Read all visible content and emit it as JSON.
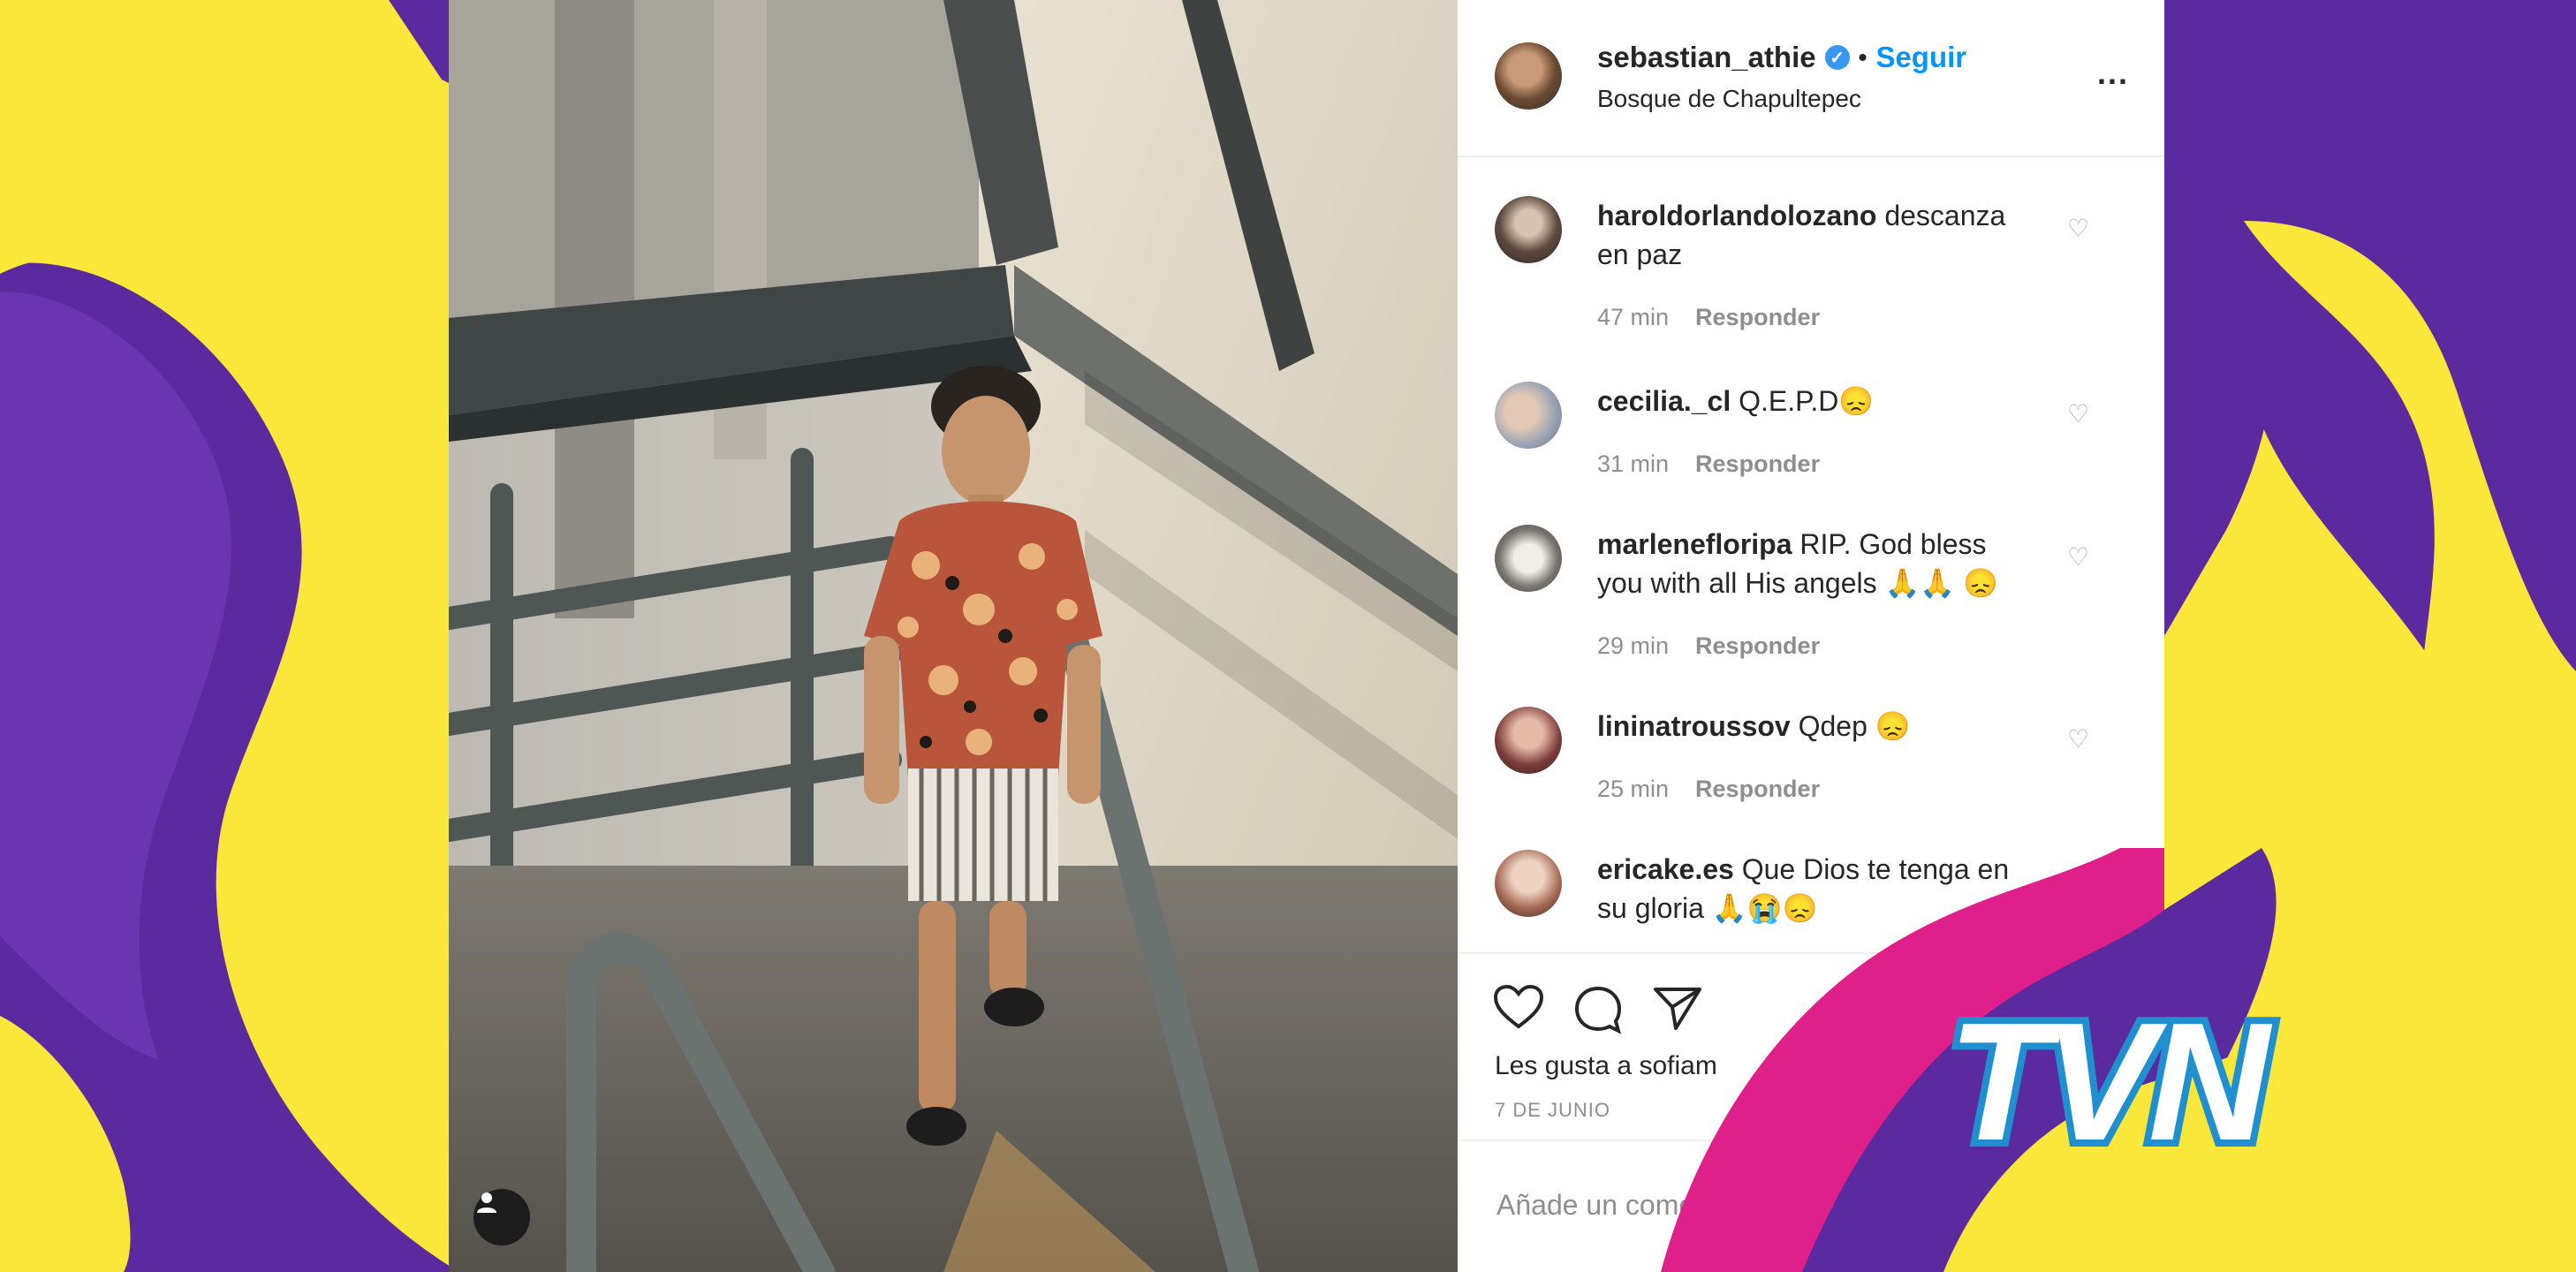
{
  "post": {
    "username": "sebastian_athie",
    "separator": "•",
    "follow_label": "Seguir",
    "location": "Bosque de Chapultepec",
    "more_label": "...",
    "verified_icon": "verified-badge-icon"
  },
  "comments": [
    {
      "username": "haroldorlandolozano",
      "text": "descanza en paz",
      "time": "47 min",
      "reply": "Responder"
    },
    {
      "username": "cecilia._cl",
      "text": "Q.E.P.D😞",
      "time": "31 min",
      "reply": "Responder"
    },
    {
      "username": "marlenefloripa",
      "text": "RIP. God bless you with all His angels 🙏🙏 😞",
      "time": "29 min",
      "reply": "Responder"
    },
    {
      "username": "lininatroussov",
      "text": "Qdep 😞",
      "time": "25 min",
      "reply": "Responder"
    },
    {
      "username": "ericake.es",
      "text": "Que Dios te tenga en su gloria 🙏😭😞",
      "time": "",
      "reply": ""
    }
  ],
  "actions": {
    "likes_text": "Les gusta a sofiam",
    "date": "7 DE JUNIO"
  },
  "add_comment": {
    "placeholder": "Añade un comentario..."
  },
  "logo": {
    "text": "TVN",
    "fill": "#ffffff",
    "outline": "#1f8fd0"
  },
  "colors": {
    "yellow": "#fbe63a",
    "purple": "#5b2a9e",
    "magenta": "#e0208a",
    "link_blue": "#0095f6"
  }
}
